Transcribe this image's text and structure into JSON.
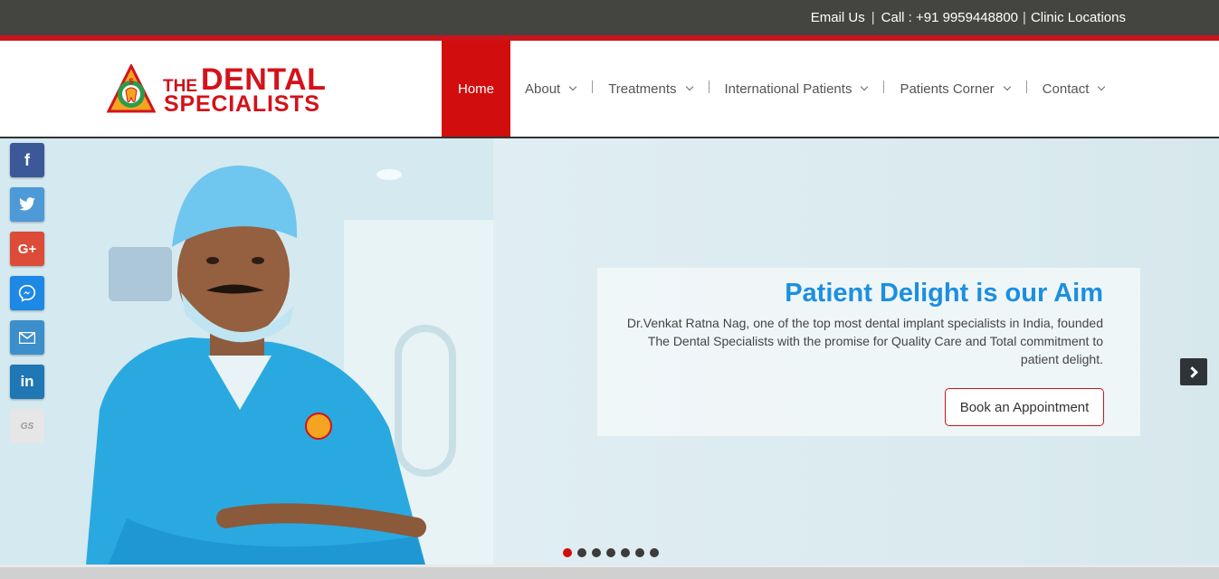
{
  "topbar": {
    "email_label": "Email Us",
    "call_label": "Call : +91 9959448800",
    "locations_label": "Clinic Locations",
    "separator": "|"
  },
  "logo": {
    "line_the": "THE",
    "line_dental": "DENTAL",
    "line_specialists": "SPECIALISTS"
  },
  "nav": {
    "items": [
      {
        "label": "Home"
      },
      {
        "label": "About"
      },
      {
        "label": "Treatments"
      },
      {
        "label": "International Patients"
      },
      {
        "label": "Patients Corner"
      },
      {
        "label": "Contact"
      }
    ]
  },
  "hero": {
    "title": "Patient Delight is our Aim",
    "text": "Dr.Venkat Ratna Nag, one of the top most dental implant specialists in India, founded The Dental Specialists with the promise for Quality Care and Total commitment to patient delight.",
    "button_label": "Book an Appointment",
    "slide_count": 7,
    "active_slide": 1
  },
  "social": {
    "items": [
      {
        "name": "facebook",
        "glyph": "f"
      },
      {
        "name": "twitter",
        "glyph": "🐦"
      },
      {
        "name": "google-plus",
        "glyph": "G+"
      },
      {
        "name": "messenger",
        "glyph": "✉"
      },
      {
        "name": "email",
        "glyph": "✉"
      },
      {
        "name": "linkedin",
        "glyph": "in"
      },
      {
        "name": "getsocial",
        "glyph": "GS"
      }
    ]
  },
  "colors": {
    "brand_red": "#d10d0d",
    "topbar_bg": "#444441",
    "title_blue": "#1b8fe0"
  }
}
